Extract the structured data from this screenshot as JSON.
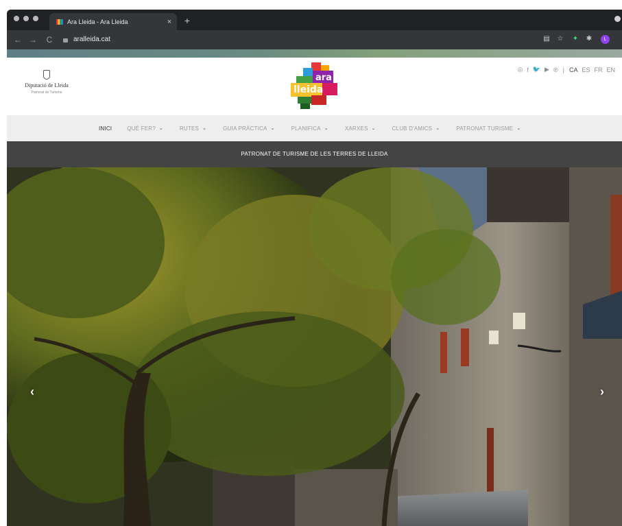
{
  "browser": {
    "tab_title": "Ara Lleida - Ara Lleida",
    "tab_close": "×",
    "new_tab": "+",
    "url": "aralleida.cat",
    "profile_initial": "L",
    "colors": {
      "frame": "#202124",
      "toolbar": "#35363a",
      "profile": "#8e44ef"
    }
  },
  "header": {
    "dipu_name": "Diputació de Lleida",
    "dipu_sub": "Patronat de Turisme",
    "logo_word_top": "ara",
    "logo_word_bottom": "lleida",
    "social_icons": [
      "instagram-icon",
      "facebook-icon",
      "twitter-icon",
      "youtube-icon",
      "pinterest-icon"
    ],
    "social_glyphs": [
      "◎",
      "f",
      "🐦",
      "▶",
      "℗"
    ],
    "separator": "|",
    "languages": [
      {
        "code": "CA",
        "active": true
      },
      {
        "code": "ES",
        "active": false
      },
      {
        "code": "FR",
        "active": false
      },
      {
        "code": "EN",
        "active": false
      }
    ]
  },
  "nav": {
    "items": [
      {
        "label": "INICI",
        "dropdown": false,
        "active": true
      },
      {
        "label": "QUÈ FER?",
        "dropdown": true,
        "active": false
      },
      {
        "label": "RUTES",
        "dropdown": true,
        "active": false
      },
      {
        "label": "GUIA PRÀCTICA",
        "dropdown": true,
        "active": false
      },
      {
        "label": "PLANIFICA",
        "dropdown": true,
        "active": false
      },
      {
        "label": "XARXES",
        "dropdown": true,
        "active": false
      },
      {
        "label": "CLUB D'AMICS",
        "dropdown": true,
        "active": false
      },
      {
        "label": "PATRONAT TURISME",
        "dropdown": true,
        "active": false
      }
    ],
    "caret": "⌄"
  },
  "subbar": {
    "text": "PATRONAT DE TURISME DE LES TERRES DE LLEIDA"
  },
  "hero": {
    "prev_arrow": "‹",
    "next_arrow": "›",
    "colors": {
      "foliage": "#6b6a1f",
      "stone": "#8a8378",
      "shadow": "#2b2a1c"
    }
  }
}
